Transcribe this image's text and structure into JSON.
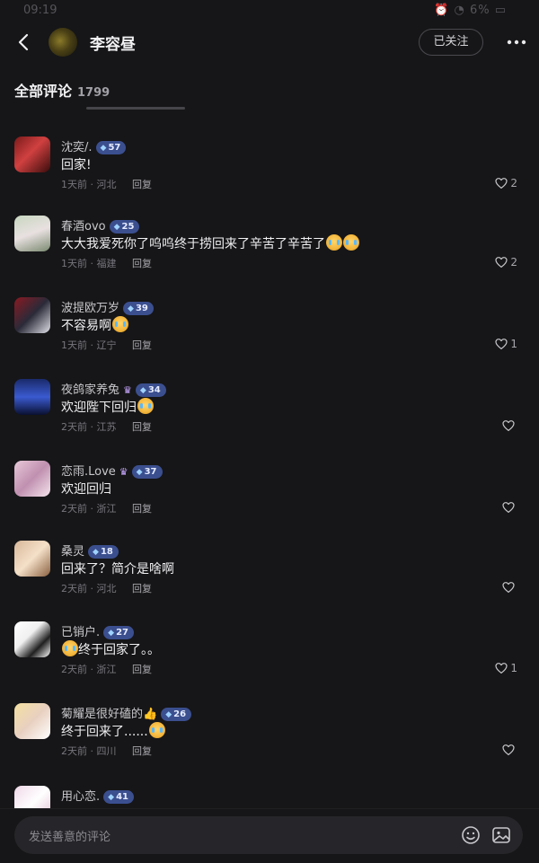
{
  "status_bar": {
    "time": "09:19",
    "right": "⏰ ◔ 6% ▭"
  },
  "header": {
    "title": "李容昼",
    "follow_label": "已关注"
  },
  "section": {
    "title": "全部评论",
    "count": "1799"
  },
  "colors": {
    "background": "#161618",
    "level_badge": "#3b4f8f",
    "crown": "#c9a8ff"
  },
  "comments": [
    {
      "name": "沈奕/.",
      "level": "57",
      "crown": false,
      "text": "回家!",
      "emoji_after": 0,
      "emoji_before": 0,
      "time": "1天前",
      "location": "河北",
      "reply": "回复",
      "likes": "2"
    },
    {
      "name": "春酒ovo",
      "level": "25",
      "crown": false,
      "text": "大大我爱死你了呜呜终于捞回来了辛苦了辛苦了",
      "emoji_after": 2,
      "emoji_before": 0,
      "time": "1天前",
      "location": "福建",
      "reply": "回复",
      "likes": "2"
    },
    {
      "name": "波提欧万岁",
      "level": "39",
      "crown": false,
      "text": "不容易啊",
      "emoji_after": 1,
      "emoji_before": 0,
      "time": "1天前",
      "location": "辽宁",
      "reply": "回复",
      "likes": "1"
    },
    {
      "name": "夜鸽家养兔",
      "level": "34",
      "crown": true,
      "text": "欢迎陛下回归",
      "emoji_after": 1,
      "emoji_before": 0,
      "time": "2天前",
      "location": "江苏",
      "reply": "回复",
      "likes": ""
    },
    {
      "name": "恋雨.Love",
      "level": "37",
      "crown": true,
      "text": "欢迎回归",
      "emoji_after": 0,
      "emoji_before": 0,
      "time": "2天前",
      "location": "浙江",
      "reply": "回复",
      "likes": ""
    },
    {
      "name": "桑灵",
      "level": "18",
      "crown": false,
      "text": "回来了？简介是啥啊",
      "emoji_after": 0,
      "emoji_before": 0,
      "time": "2天前",
      "location": "河北",
      "reply": "回复",
      "likes": ""
    },
    {
      "name": "已销户.",
      "level": "27",
      "crown": false,
      "text": "终于回家了。。",
      "emoji_after": 0,
      "emoji_before": 1,
      "time": "2天前",
      "location": "浙江",
      "reply": "回复",
      "likes": "1"
    },
    {
      "name": "菊耀是很好磕的👍",
      "level": "26",
      "crown": false,
      "text": "终于回来了......",
      "emoji_after": 1,
      "emoji_before": 0,
      "time": "2天前",
      "location": "四川",
      "reply": "回复",
      "likes": ""
    },
    {
      "name": "用心恋.",
      "level": "41",
      "crown": false,
      "text": "",
      "emoji_after": 0,
      "emoji_before": 0,
      "time": "",
      "location": "",
      "reply": "",
      "likes": ""
    }
  ],
  "input": {
    "placeholder": "发送善意的评论"
  },
  "icons": {
    "back": "chevron-left-icon",
    "more": "more-dots-icon",
    "like": "heart-icon",
    "emoji": "emoji-smile-icon",
    "image": "image-icon",
    "level": "diamond-gem-icon",
    "crown": "crown-icon"
  }
}
